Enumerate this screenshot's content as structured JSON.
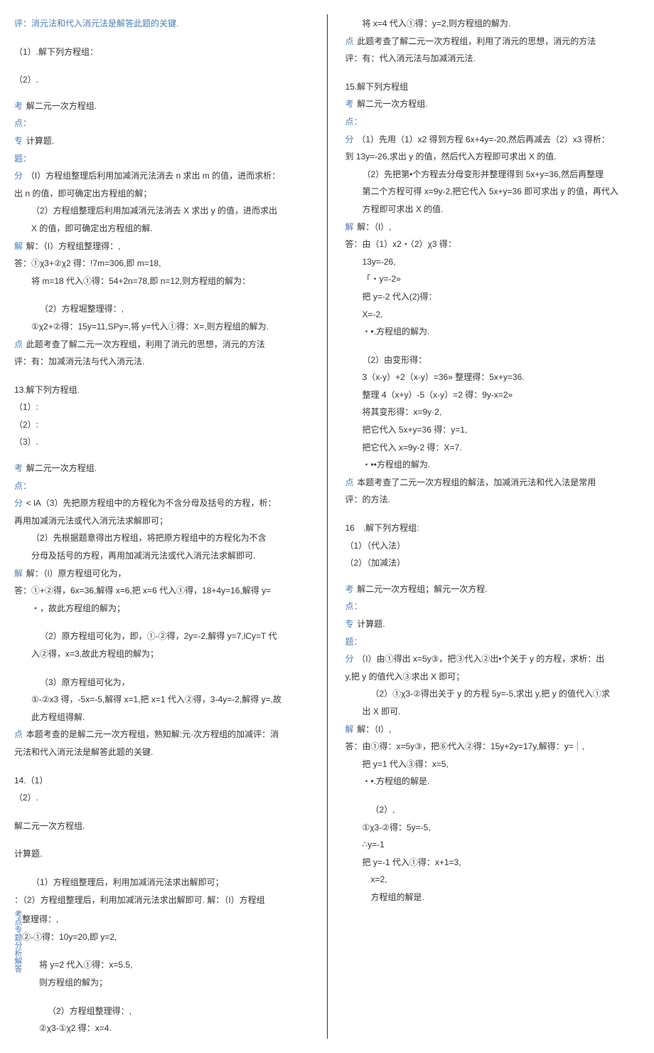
{
  "left": {
    "l1": "评：消元法和代入消元法是解答此题的关键.",
    "l2": "（1）.解下列方程组：",
    "l3": "（2）.",
    "l4a": "考",
    "l4b": "解二元一次方程组.",
    "l5a": "点：",
    "l6a": "专",
    "l6b": "计算题.",
    "l7a": "题：",
    "l8a": "分",
    "l8b": "（I）方程组整理后利用加减消元法消去 n 求出 m 的值，进而求析：",
    "l9": "出 n 的值，即可确定出方程组的解；",
    "l10": "（2）方程组整理后利用加减消元法消去 X 求出 y 的值，进而求出",
    "l11": "X 的值，即可确定出方程组的解.",
    "l12a": "解",
    "l12b": "解：（I）方程组整理得：,",
    "l13": "答：①χ3+②χ2 得：!7m=306,即 m=18,",
    "l14": "将 m=18 代入①得：54+2n=78,即 n=12,则方程组的解为：",
    "l15": "（2）方程堀整理得：,",
    "l16": "①χ2+②得：15y=11,SPy=,将 y=代入①得：X=,则方程组的解为.",
    "l17a": "点",
    "l17b": "此题考查了解二元一次方程组，利用了消元的思想，消元的方法",
    "l18": "评：有：加减消元法与代入消元法.",
    "l19": "13.解下列方程组.",
    "l20": "（1）:",
    "l21": "（2）:",
    "l22": "（3）.",
    "l23a": "考",
    "l23b": "解二元一次方程组.",
    "l24a": "点：",
    "l25a": "分",
    "l25b": "< lA（3）先把原方程组中的方程化为不含分母及括号的方程，析：",
    "l26": "再用加减消元法或代入消元法求解即可；",
    "l27": "（2）先根据题意得出方程组，将把原方程组中的方程化为不含",
    "l28": "分母及括号的方程，再用加减消元法或代入消元法求解即可.",
    "l29a": "解",
    "l29b": "解：（l）原方程组可化为，",
    "l30": "答：①+②得，6x=36,解得 x=6,把 x=6 代入①得，18+4y=16,解得 y=",
    "l31": "・，故此方程组的解为；",
    "l32": "（2）原方程组可化为，即，①-②得，2y=-2,解得 y=7,lCy=T 代",
    "l33": "入②得，x=3,故此方程组的解为；",
    "l34": "（3）原方程组可化为，",
    "l35": "①-②x3 得，-5x=-5,解得 x=1,把 x=1 代入②得，3-4y=-2,解得 y=,故",
    "l36": "此方程组得解.",
    "l37a": "点",
    "l37b": "本题考查的是解二元一次方程组，熟知解:元·次方程组的加减评：消",
    "l38": "元法和代入消元法是解答此题的关键.",
    "l39": "14.（1）",
    "l40": "（2）.",
    "l41": "解二元一次方程组.",
    "l42": "计算题.",
    "l43": "（1）方程组整理后，利用加减消元法求出解即可；",
    "l44": "：（2）方程组整理后，利用加减消元法求出解即可. 解：（I）方程组",
    "l45": "整理得：,",
    "l46": "②-①得：10y=20,即 y=2,",
    "l47": "将 y=2 代入①得：x=5.5,",
    "l48": "则方程组的解为；",
    "l49": "（2）方程组整理得：,",
    "l50": "②χ3-①χ2 得：x=4.",
    "vlabel": "考点专题分析解答"
  },
  "right": {
    "r1": "将 x=4 代入①得：y=2,则方程组的解为.",
    "r2a": "点",
    "r2b": "此题考查了解二元一次方程组，利用了消元的思想，消元的方法",
    "r3": "评：有：代入消元法与加减消元法.",
    "r4": "15.解下列方程组",
    "r5a": "考",
    "r5b": "解二元一次方程组.",
    "r6a": "点：",
    "r7a": "分",
    "r7b": "（1）先用（1）x2 得到方程 6x+4y=-20,然后再减去（2）x3 得析：",
    "r8": "到 13y=-26,求出 y 的值，然后代入方程即可求出 X 的值.",
    "r9": "（2）先把第•个方程去分母变形并整理得到 5x+y=36,然后再整理",
    "r10": "第二个方程可得 x=9y-2,把它代入 5x+y=36 即可求出 y 的值，再代入",
    "r11": "方程即可求出 X 的值.",
    "r12a": "解",
    "r12b": "解：（l）,",
    "r13": "答：由（1）x2・（2）χ3 得：",
    "r14": "13y=-26,",
    "r15": "「・y=-2»",
    "r16": "把 y=-2 代入(2)得：",
    "r17": "X=-2,",
    "r18": "・•.方程组的解为.",
    "r19": "（2）由变形得：",
    "r20": "3（x-y）+2（x-y）=36» 整理得：5x+y=36.",
    "r21": "整理 4（x+y）-5（x-y）=2 得：9y-x=2»",
    "r22": "将其变形得：x=9y·2,",
    "r23": "把它代入 5x+y=36 得：y=1,",
    "r24": "把它代入 x=9y-2 得：X=7.",
    "r25": "・••方程组的解为.",
    "r26a": "点",
    "r26b": "本题考查了二元一次方程组的解法，加减消元法和代入法是常用",
    "r27": "评：的方法.",
    "r28": "16　.解下列方程组:",
    "r29": "（1）（代入法）",
    "r30": "（2）（加减法）",
    "r31a": "考",
    "r31b": "解二元一次方程组；解元一次方程.",
    "r32a": "点：",
    "r33a": "专",
    "r33b": "计算题.",
    "r34a": "题：",
    "r35a": "分",
    "r35b": "（I）由①得出 x=5y③，把③代入②出•个关于 y 的方程，求析：出",
    "r36": "y,把 y 的值代入③求出 X 即可；",
    "r37": "（2）①χ3-②得出关于 y 的方程 5y=-5,求出 y,把 y 的值代入①求",
    "r38": "出 X 即可.",
    "r39a": "解",
    "r39b": "解：（l）,",
    "r40": "答：由①得：x=5y③，把⑥代入②得：15y+2y=17y,解得：y=｜,",
    "r41": "把 y=1 代入③得：x=5,",
    "r42": "・•.方程组的解是.",
    "r43": "（2）,",
    "r44": "①χ3-②得：5y=-5,",
    "r45": "∴y=-1",
    "r46": "把 y=-1 代入①得：x+1=3,",
    "r47": "x=2,",
    "r48": "方程组的解是."
  }
}
